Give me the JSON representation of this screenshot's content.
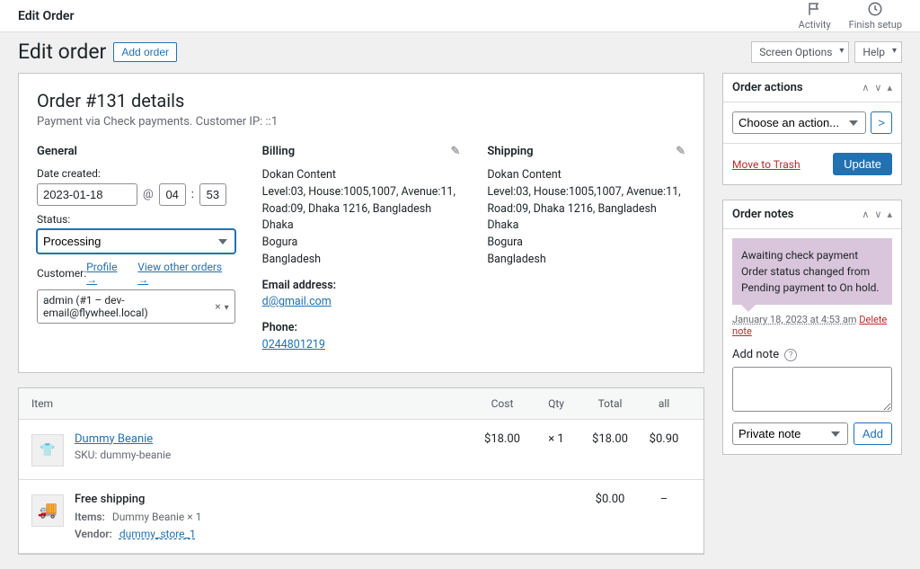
{
  "topbar": {
    "title": "Edit Order",
    "activity": "Activity",
    "finish": "Finish setup"
  },
  "header": {
    "heading": "Edit order",
    "add_order": "Add order",
    "screen_options": "Screen Options",
    "help": "Help"
  },
  "order": {
    "title": "Order #131 details",
    "sub": "Payment via Check payments. Customer IP: ::1",
    "general_h": "General",
    "date_label": "Date created:",
    "date": "2023-01-18",
    "at": "@",
    "hour": "04",
    "colon": ":",
    "minute": "53",
    "status_label": "Status:",
    "status": "Processing",
    "customer_label": "Customer:",
    "profile_link": "Profile →",
    "view_other": "View other orders →",
    "customer_value": "admin (#1 – dev-email@flywheel.local)"
  },
  "billing": {
    "h": "Billing",
    "line1": "Dokan Content",
    "line2": "Level:03, House:1005,1007, Avenue:11, Road:09, Dhaka 1216, Bangladesh",
    "line3": "Dhaka",
    "line4": "Bogura",
    "line5": "Bangladesh",
    "email_label": "Email address:",
    "email": "d@gmail.com",
    "phone_label": "Phone:",
    "phone": "0244801219"
  },
  "shipping": {
    "h": "Shipping",
    "line1": "Dokan Content",
    "line2": "Level:03, House:1005,1007, Avenue:11, Road:09, Dhaka 1216, Bangladesh",
    "line3": "Dhaka",
    "line4": "Bogura",
    "line5": "Bangladesh"
  },
  "items": {
    "h_item": "Item",
    "h_cost": "Cost",
    "h_qty": "Qty",
    "h_total": "Total",
    "h_all": "all",
    "row1": {
      "name": "Dummy Beanie",
      "sku_label": "SKU:",
      "sku": "dummy-beanie",
      "cost": "$18.00",
      "qty": "× 1",
      "total": "$18.00",
      "all": "$0.90"
    },
    "row2": {
      "name": "Free shipping",
      "items_label": "Items:",
      "items_val": "Dummy Beanie × 1",
      "vendor_label": "Vendor:",
      "vendor_val": "dummy_store_1",
      "total": "$0.00",
      "all": "–"
    }
  },
  "actions": {
    "title": "Order actions",
    "placeholder": "Choose an action...",
    "trash": "Move to Trash",
    "update": "Update"
  },
  "notes": {
    "title": "Order notes",
    "note1": "Awaiting check payment Order status changed from Pending payment to On hold.",
    "note1_meta": "January 18, 2023 at 4:53 am",
    "delete": "Delete note",
    "add_note": "Add note",
    "type": "Private note",
    "add_btn": "Add"
  }
}
